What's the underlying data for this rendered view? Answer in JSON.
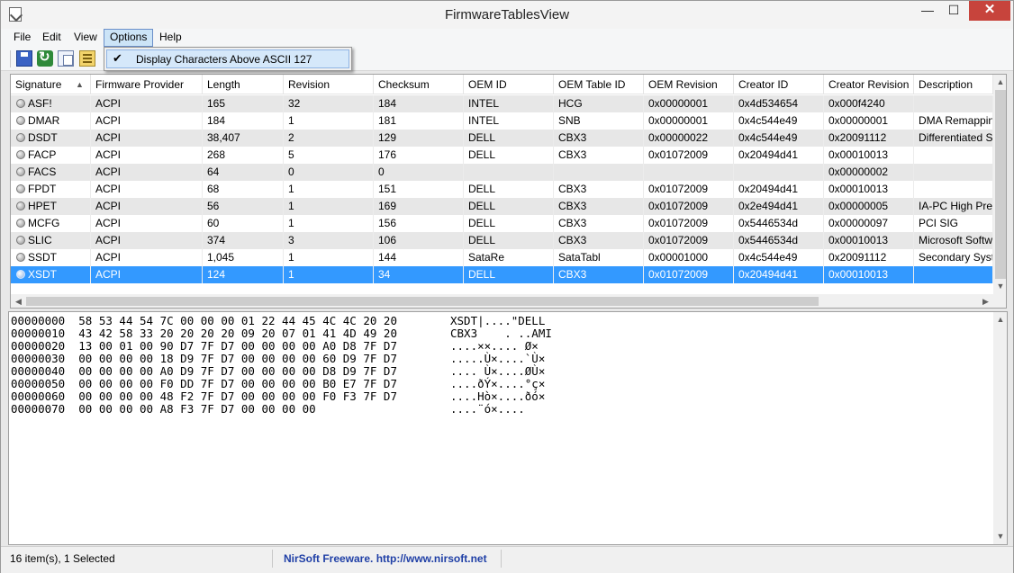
{
  "window": {
    "title": "FirmwareTablesView",
    "minimize": "—",
    "maximize": "☐",
    "close": "✕"
  },
  "menu": [
    "File",
    "Edit",
    "View",
    "Options",
    "Help"
  ],
  "toolbar": [
    "save-icon",
    "refresh-icon",
    "copy-icon",
    "properties-icon"
  ],
  "dropdown": {
    "checked": true,
    "label": "Display Characters Above ASCII 127"
  },
  "table": {
    "columns": [
      "Signature",
      "Firmware Provider",
      "Length",
      "Revision",
      "Checksum",
      "OEM ID",
      "OEM Table ID",
      "OEM Revision",
      "Creator ID",
      "Creator Revision",
      "Description"
    ],
    "sort_indicator": "▲",
    "rows": [
      [
        "ASF!",
        "ACPI",
        "165",
        "32",
        "184",
        "INTEL",
        "HCG",
        "0x00000001",
        "0x4d534654",
        "0x000f4240",
        ""
      ],
      [
        "DMAR",
        "ACPI",
        "184",
        "1",
        "181",
        "INTEL",
        "SNB",
        "0x00000001",
        "0x4c544e49",
        "0x00000001",
        "DMA Remapping"
      ],
      [
        "DSDT",
        "ACPI",
        "38,407",
        "2",
        "129",
        "DELL",
        "CBX3",
        "0x00000022",
        "0x4c544e49",
        "0x20091112",
        "Differentiated S"
      ],
      [
        "FACP",
        "ACPI",
        "268",
        "5",
        "176",
        "DELL",
        "CBX3",
        "0x01072009",
        "0x20494d41",
        "0x00010013",
        ""
      ],
      [
        "FACS",
        "ACPI",
        "64",
        "0",
        "0",
        "",
        "",
        "",
        "",
        "0x00000002",
        ""
      ],
      [
        "FPDT",
        "ACPI",
        "68",
        "1",
        "151",
        "DELL",
        "CBX3",
        "0x01072009",
        "0x20494d41",
        "0x00010013",
        ""
      ],
      [
        "HPET",
        "ACPI",
        "56",
        "1",
        "169",
        "DELL",
        "CBX3",
        "0x01072009",
        "0x2e494d41",
        "0x00000005",
        "IA-PC High Pre"
      ],
      [
        "MCFG",
        "ACPI",
        "60",
        "1",
        "156",
        "DELL",
        "CBX3",
        "0x01072009",
        "0x5446534d",
        "0x00000097",
        "PCI SIG"
      ],
      [
        "SLIC",
        "ACPI",
        "374",
        "3",
        "106",
        "DELL",
        "CBX3",
        "0x01072009",
        "0x5446534d",
        "0x00010013",
        "Microsoft Softw"
      ],
      [
        "SSDT",
        "ACPI",
        "1,045",
        "1",
        "144",
        "SataRe",
        "SataTabl",
        "0x00001000",
        "0x4c544e49",
        "0x20091112",
        "Secondary Syste"
      ],
      [
        "XSDT",
        "ACPI",
        "124",
        "1",
        "34",
        "DELL",
        "CBX3",
        "0x01072009",
        "0x20494d41",
        "0x00010013",
        ""
      ]
    ],
    "selected_row": 10
  },
  "hex": [
    {
      "addr": "00000000",
      "bytes": "58 53 44 54 7C 00 00 00 01 22 44 45 4C 4C 20 20",
      "ascii": "XSDT|....\"DELL  "
    },
    {
      "addr": "00000010",
      "bytes": "43 42 58 33 20 20 20 20 09 20 07 01 41 4D 49 20",
      "ascii": "CBX3    . ..AMI "
    },
    {
      "addr": "00000020",
      "bytes": "13 00 01 00 90 D7 7F D7 00 00 00 00 A0 D8 7F D7",
      "ascii": "....××.... Ø×"
    },
    {
      "addr": "00000030",
      "bytes": "00 00 00 00 18 D9 7F D7 00 00 00 00 60 D9 7F D7",
      "ascii": ".....Ù×....`Ù×"
    },
    {
      "addr": "00000040",
      "bytes": "00 00 00 00 A0 D9 7F D7 00 00 00 00 D8 D9 7F D7",
      "ascii": ".... Ù×....ØÙ×"
    },
    {
      "addr": "00000050",
      "bytes": "00 00 00 00 F0 DD 7F D7 00 00 00 00 B0 E7 7F D7",
      "ascii": "....ðÝ×....°ç×"
    },
    {
      "addr": "00000060",
      "bytes": "00 00 00 00 48 F2 7F D7 00 00 00 00 F0 F3 7F D7",
      "ascii": "....Hò×....ðó×"
    },
    {
      "addr": "00000070",
      "bytes": "00 00 00 00 A8 F3 7F D7 00 00 00 00",
      "ascii": "....¨ó×...."
    }
  ],
  "status": {
    "items": "16 item(s), 1 Selected",
    "credit": "NirSoft Freeware.  http://www.nirsoft.net"
  }
}
